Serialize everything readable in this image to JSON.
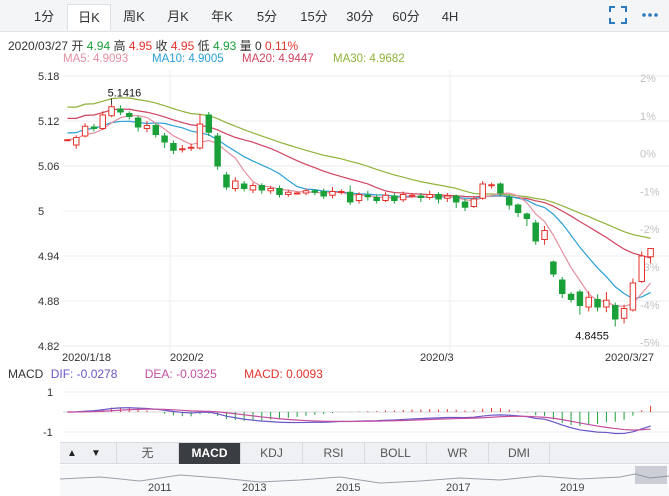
{
  "tabs": [
    {
      "label": "1分",
      "active": false
    },
    {
      "label": "日K",
      "active": true
    },
    {
      "label": "周K",
      "active": false
    },
    {
      "label": "月K",
      "active": false
    },
    {
      "label": "年K",
      "active": false
    },
    {
      "label": "5分",
      "active": false
    },
    {
      "label": "15分",
      "active": false
    },
    {
      "label": "30分",
      "active": false
    },
    {
      "label": "60分",
      "active": false
    },
    {
      "label": "4H",
      "active": false
    }
  ],
  "toolbar": {
    "icons": [
      "fullscreen-icon",
      "more-icon"
    ]
  },
  "info": {
    "date": "2020/03/27",
    "open_label": "开",
    "open": "4.94",
    "high_label": "高",
    "high": "4.95",
    "close_label": "收",
    "close": "4.95",
    "low_label": "低",
    "low": "4.93",
    "volume_label": "量",
    "volume": "0",
    "change": "0.11%"
  },
  "ma": {
    "ma5": "MA5: 4.9093",
    "ma10": "MA10: 4.9005",
    "ma20": "MA20: 4.9447",
    "ma30": "MA30: 4.9682"
  },
  "colors": {
    "up": "#e5322b",
    "down": "#1aa038",
    "ma5": "#e58fa1",
    "ma10": "#2a9fd6",
    "ma20": "#d0435e",
    "ma30": "#8fb33b",
    "pct_label": "#c2c2c2"
  },
  "chart_data": {
    "type": "candlestick",
    "y_ticks": [
      "5.18",
      "5.12",
      "5.06",
      "5",
      "4.94",
      "4.88",
      "4.82"
    ],
    "ylim": [
      4.82,
      5.18
    ],
    "pct_ticks": [
      "2%",
      "1%",
      "0%",
      "-1%",
      "-2%",
      "-3%",
      "-4%",
      "-5%"
    ],
    "x_ticks": [
      "2020/1/18",
      "2020/2",
      "2020/3",
      "2020/3/27"
    ],
    "annotations": {
      "high": "5.1416",
      "low": "4.8455"
    },
    "candles": [
      {
        "o": 5.094,
        "c": 5.095,
        "h": 5.096,
        "l": 5.093
      },
      {
        "o": 5.088,
        "c": 5.098,
        "h": 5.101,
        "l": 5.083
      },
      {
        "o": 5.1,
        "c": 5.113,
        "h": 5.117,
        "l": 5.098
      },
      {
        "o": 5.112,
        "c": 5.11,
        "h": 5.116,
        "l": 5.106
      },
      {
        "o": 5.11,
        "c": 5.128,
        "h": 5.133,
        "l": 5.108
      },
      {
        "o": 5.127,
        "c": 5.139,
        "h": 5.142,
        "l": 5.125
      },
      {
        "o": 5.136,
        "c": 5.132,
        "h": 5.141,
        "l": 5.128
      },
      {
        "o": 5.13,
        "c": 5.126,
        "h": 5.133,
        "l": 5.122
      },
      {
        "o": 5.124,
        "c": 5.112,
        "h": 5.127,
        "l": 5.106
      },
      {
        "o": 5.11,
        "c": 5.114,
        "h": 5.12,
        "l": 5.105
      },
      {
        "o": 5.114,
        "c": 5.102,
        "h": 5.117,
        "l": 5.098
      },
      {
        "o": 5.1,
        "c": 5.092,
        "h": 5.104,
        "l": 5.084
      },
      {
        "o": 5.09,
        "c": 5.081,
        "h": 5.094,
        "l": 5.076
      },
      {
        "o": 5.082,
        "c": 5.083,
        "h": 5.088,
        "l": 5.078
      },
      {
        "o": 5.084,
        "c": 5.085,
        "h": 5.09,
        "l": 5.08
      },
      {
        "o": 5.084,
        "c": 5.116,
        "h": 5.129,
        "l": 5.082
      },
      {
        "o": 5.128,
        "c": 5.105,
        "h": 5.132,
        "l": 5.1
      },
      {
        "o": 5.1,
        "c": 5.06,
        "h": 5.104,
        "l": 5.055
      },
      {
        "o": 5.048,
        "c": 5.032,
        "h": 5.052,
        "l": 5.028
      },
      {
        "o": 5.03,
        "c": 5.04,
        "h": 5.045,
        "l": 5.026
      },
      {
        "o": 5.036,
        "c": 5.03,
        "h": 5.04,
        "l": 5.026
      },
      {
        "o": 5.028,
        "c": 5.034,
        "h": 5.038,
        "l": 5.024
      },
      {
        "o": 5.034,
        "c": 5.028,
        "h": 5.037,
        "l": 5.023
      },
      {
        "o": 5.027,
        "c": 5.03,
        "h": 5.033,
        "l": 5.023
      },
      {
        "o": 5.03,
        "c": 5.022,
        "h": 5.034,
        "l": 5.018
      },
      {
        "o": 5.022,
        "c": 5.025,
        "h": 5.028,
        "l": 5.019
      },
      {
        "o": 5.024,
        "c": 5.024,
        "h": 5.026,
        "l": 5.022
      },
      {
        "o": 5.024,
        "c": 5.027,
        "h": 5.03,
        "l": 5.021
      },
      {
        "o": 5.027,
        "c": 5.025,
        "h": 5.029,
        "l": 5.021
      },
      {
        "o": 5.026,
        "c": 5.02,
        "h": 5.03,
        "l": 5.016
      },
      {
        "o": 5.021,
        "c": 5.026,
        "h": 5.032,
        "l": 5.017
      },
      {
        "o": 5.025,
        "c": 5.026,
        "h": 5.029,
        "l": 5.022
      },
      {
        "o": 5.025,
        "c": 5.012,
        "h": 5.034,
        "l": 5.008
      },
      {
        "o": 5.014,
        "c": 5.022,
        "h": 5.025,
        "l": 5.01
      },
      {
        "o": 5.021,
        "c": 5.019,
        "h": 5.027,
        "l": 5.014
      },
      {
        "o": 5.018,
        "c": 5.014,
        "h": 5.022,
        "l": 5.01
      },
      {
        "o": 5.014,
        "c": 5.021,
        "h": 5.025,
        "l": 5.012
      },
      {
        "o": 5.02,
        "c": 5.014,
        "h": 5.024,
        "l": 5.01
      },
      {
        "o": 5.015,
        "c": 5.022,
        "h": 5.026,
        "l": 5.012
      },
      {
        "o": 5.021,
        "c": 5.021,
        "h": 5.024,
        "l": 5.018
      },
      {
        "o": 5.02,
        "c": 5.018,
        "h": 5.024,
        "l": 5.012
      },
      {
        "o": 5.018,
        "c": 5.022,
        "h": 5.027,
        "l": 5.015
      },
      {
        "o": 5.022,
        "c": 5.016,
        "h": 5.025,
        "l": 5.01
      },
      {
        "o": 5.017,
        "c": 5.02,
        "h": 5.024,
        "l": 5.012
      },
      {
        "o": 5.02,
        "c": 5.012,
        "h": 5.022,
        "l": 5.004
      },
      {
        "o": 5.012,
        "c": 5.005,
        "h": 5.016,
        "l": 5.0
      },
      {
        "o": 5.006,
        "c": 5.016,
        "h": 5.02,
        "l": 5.004
      },
      {
        "o": 5.017,
        "c": 5.036,
        "h": 5.04,
        "l": 5.015
      },
      {
        "o": 5.034,
        "c": 5.035,
        "h": 5.038,
        "l": 5.03
      },
      {
        "o": 5.036,
        "c": 5.024,
        "h": 5.038,
        "l": 5.02
      },
      {
        "o": 5.018,
        "c": 5.008,
        "h": 5.022,
        "l": 5.002
      },
      {
        "o": 5.008,
        "c": 4.998,
        "h": 5.01,
        "l": 4.992
      },
      {
        "o": 4.996,
        "c": 4.99,
        "h": 4.998,
        "l": 4.98
      },
      {
        "o": 4.984,
        "c": 4.96,
        "h": 4.988,
        "l": 4.955
      },
      {
        "o": 4.962,
        "c": 4.974,
        "h": 4.98,
        "l": 4.955
      },
      {
        "o": 4.932,
        "c": 4.916,
        "h": 4.934,
        "l": 4.912
      },
      {
        "o": 4.908,
        "c": 4.89,
        "h": 4.912,
        "l": 4.884
      },
      {
        "o": 4.889,
        "c": 4.882,
        "h": 4.892,
        "l": 4.878
      },
      {
        "o": 4.892,
        "c": 4.874,
        "h": 4.895,
        "l": 4.862
      },
      {
        "o": 4.872,
        "c": 4.885,
        "h": 4.893,
        "l": 4.866
      },
      {
        "o": 4.882,
        "c": 4.872,
        "h": 4.889,
        "l": 4.866
      },
      {
        "o": 4.872,
        "c": 4.881,
        "h": 4.892,
        "l": 4.865
      },
      {
        "o": 4.874,
        "c": 4.856,
        "h": 4.878,
        "l": 4.846
      },
      {
        "o": 4.857,
        "c": 4.87,
        "h": 4.875,
        "l": 4.85
      },
      {
        "o": 4.868,
        "c": 4.904,
        "h": 4.91,
        "l": 4.866
      },
      {
        "o": 4.906,
        "c": 4.94,
        "h": 4.946,
        "l": 4.904
      },
      {
        "o": 4.939,
        "c": 4.95,
        "h": 4.95,
        "l": 4.93
      }
    ],
    "macd": {
      "label": "MACD",
      "dif": "DIF: -0.0278",
      "dea": "DEA: -0.0325",
      "macd": "MACD: 0.0093",
      "y_ticks": [
        "1",
        "-1"
      ]
    },
    "overview_years": [
      "2011",
      "2013",
      "2015",
      "2017",
      "2019"
    ]
  },
  "indicator_tabs": [
    {
      "label": "无",
      "active": false
    },
    {
      "label": "MACD",
      "active": true
    },
    {
      "label": "KDJ",
      "active": false
    },
    {
      "label": "RSI",
      "active": false
    },
    {
      "label": "BOLL",
      "active": false
    },
    {
      "label": "WR",
      "active": false
    },
    {
      "label": "DMI",
      "active": false
    }
  ],
  "nav_arrows": [
    "▲",
    "▼"
  ]
}
